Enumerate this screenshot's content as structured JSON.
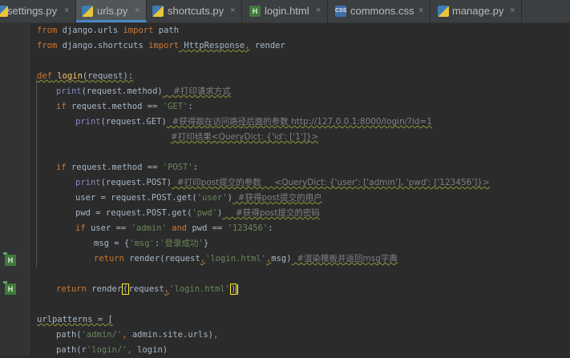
{
  "tabs": [
    {
      "label": "settings.py",
      "icon": "python-file-icon",
      "active": false
    },
    {
      "label": "urls.py",
      "icon": "python-file-icon",
      "active": true
    },
    {
      "label": "shortcuts.py",
      "icon": "python-file-icon",
      "active": false
    },
    {
      "label": "login.html",
      "icon": "html-file-icon",
      "active": false
    },
    {
      "label": "commons.css",
      "icon": "css-file-icon",
      "active": false
    },
    {
      "label": "manage.py",
      "icon": "python-file-icon",
      "active": false
    }
  ],
  "tab_close_glyph": "×",
  "icon_texts": {
    "html": "H",
    "css": "CSS"
  },
  "code": {
    "l1": [
      "from",
      " django.urls ",
      "import",
      " path"
    ],
    "l2": [
      "from",
      " django.shortcuts ",
      "import",
      " HttpResponse",
      ",",
      " render"
    ],
    "l4": [
      "def",
      " ",
      "login",
      "(request):"
    ],
    "l5": [
      "print",
      "(request.method)",
      "    #打印请求方式"
    ],
    "l6": [
      "if",
      " request.method == ",
      "'GET'",
      ":"
    ],
    "l7": [
      "print",
      "(request.GET)",
      "  #获得跟在访问路径后面的参数 http://127.0.0.1:8000/login/?id=1"
    ],
    "l8": [
      "#打印结果<QueryDict: {'id': ['1']}>"
    ],
    "l10": [
      "if",
      " request.method == ",
      "'POST'",
      ":"
    ],
    "l11": [
      "print",
      "(request.POST)",
      "  #打印post提交的参数     <QueryDict: {'user': ['admin'], 'pwd': ['123456']}>"
    ],
    "l12": [
      "user = request.POST.get(",
      "'user'",
      ")",
      "  #获得post提交的用户"
    ],
    "l13": [
      "pwd = request.POST.get(",
      "'pwd'",
      ")",
      "     #获得post提交的密码"
    ],
    "l14": [
      "if",
      " user == ",
      "'admin'",
      " and ",
      "pwd == ",
      "'123456'",
      ":"
    ],
    "l15": [
      "msg = {",
      "'msg'",
      ":",
      "'登录成功'",
      "}"
    ],
    "l16": [
      "return",
      " render(request",
      ",",
      "'login.html'",
      ",",
      "msg)",
      "  #渲染模板并返回msg字典"
    ],
    "l18": [
      "return",
      " render",
      "(",
      "request",
      ",",
      "'login.html'",
      ")"
    ],
    "l20": [
      "urlpatterns = ["
    ],
    "l21": [
      "path(",
      "'admin/'",
      ",",
      " admin.site.urls)",
      ","
    ],
    "l22": [
      "path(r",
      "'login/'",
      ",",
      " login)"
    ]
  }
}
